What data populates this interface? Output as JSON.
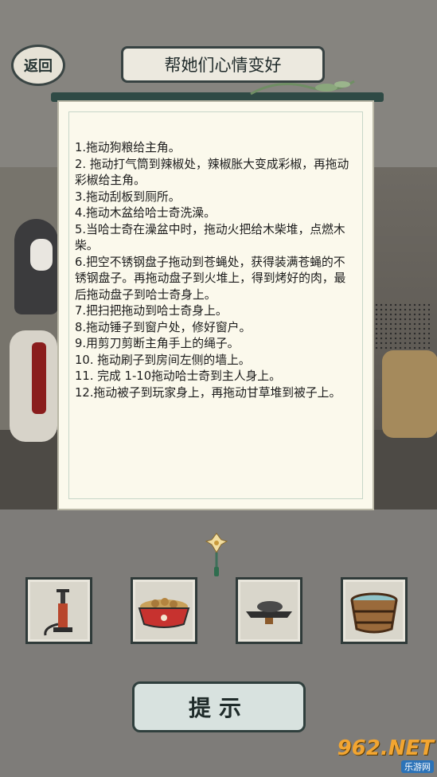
{
  "header": {
    "back_label": "返回",
    "title": "帮她们心情变好"
  },
  "walkthrough": {
    "steps": [
      "1.拖动狗粮给主角。",
      "2. 拖动打气筒到辣椒处，辣椒胀大变成彩椒，再拖动彩椒给主角。",
      "3.拖动刮板到厕所。",
      "4.拖动木盆给哈士奇洗澡。",
      "5.当哈士奇在澡盆中时，拖动火把给木柴堆，点燃木柴。",
      "6.把空不锈钢盘子拖动到苍蝇处，获得装满苍蝇的不锈钢盘子。再拖动盘子到火堆上，得到烤好的肉，最后拖动盘子到哈士奇身上。",
      "7.把扫把拖动到哈士奇身上。",
      "8.拖动锤子到窗户处，修好窗户。",
      "9.用剪刀剪断主角手上的绳子。",
      "10. 拖动刷子到房间左侧的墙上。",
      "11. 完成 1-10拖动哈士奇到主人身上。",
      "12.拖动被子到玩家身上，再拖动甘草堆到被子上。"
    ]
  },
  "inventory": {
    "items": [
      {
        "icon": "air-pump-icon"
      },
      {
        "icon": "dog-food-bowl-icon"
      },
      {
        "icon": "scraper-icon"
      },
      {
        "icon": "wooden-tub-icon"
      }
    ]
  },
  "hint_button": {
    "label": "提示"
  },
  "watermark": {
    "main": "962.NET",
    "sub": "乐游网"
  },
  "colors": {
    "panel_bg": "#fbf9ec",
    "frame_dark": "#2f3f3d",
    "accent_gold": "#f2a531"
  }
}
